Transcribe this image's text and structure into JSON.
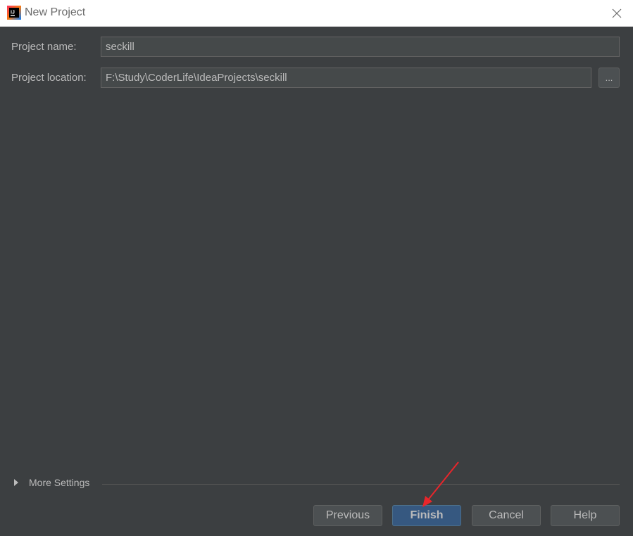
{
  "window": {
    "title": "New Project",
    "app_icon_label": "IJ"
  },
  "form": {
    "project_name_label": "Project name:",
    "project_name_value": "seckill",
    "project_location_label": "Project location:",
    "project_location_value": "F:\\Study\\CoderLife\\IdeaProjects\\seckill",
    "browse_label": "..."
  },
  "more_settings": {
    "label": "More Settings"
  },
  "buttons": {
    "previous": "Previous",
    "finish": "Finish",
    "cancel": "Cancel",
    "help": "Help"
  },
  "colors": {
    "background": "#3c3f41",
    "field_bg": "#45494a",
    "primary_button": "#365880",
    "text": "#bbbbbb",
    "annotation_arrow": "#e8262b"
  },
  "icons": {
    "app": "intellij-idea-icon",
    "close": "close-icon",
    "expand": "triangle-right-icon"
  }
}
